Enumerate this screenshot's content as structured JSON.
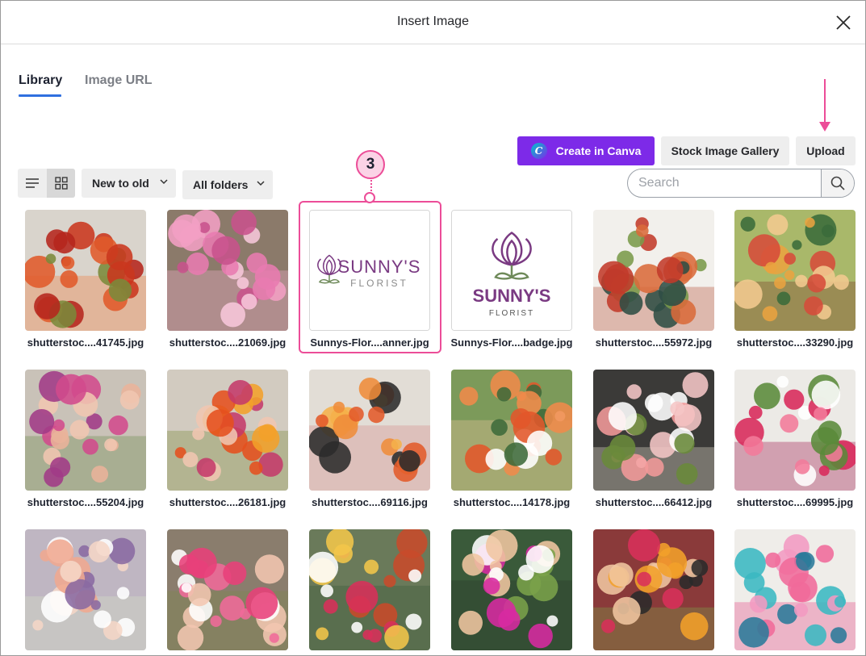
{
  "dialog": {
    "title": "Insert Image"
  },
  "tabs": [
    {
      "label": "Library",
      "active": true
    },
    {
      "label": "Image URL",
      "active": false
    }
  ],
  "actions": {
    "canva_label": "Create in Canva",
    "canva_logo_letter": "C",
    "stock_label": "Stock Image Gallery",
    "upload_label": "Upload"
  },
  "toolbar": {
    "sort_value": "New to old",
    "folder_value": "All folders",
    "search_placeholder": "Search"
  },
  "callout": {
    "step": "3"
  },
  "images": [
    {
      "name": "shutterstoc....41745.jpg",
      "kind": "wreath",
      "selected": false
    },
    {
      "name": "shutterstoc....21069.jpg",
      "kind": "pink-flowers",
      "selected": false
    },
    {
      "name": "Sunnys-Flor....anner.jpg",
      "kind": "logo-banner",
      "selected": true
    },
    {
      "name": "Sunnys-Flor....badge.jpg",
      "kind": "logo-badge",
      "selected": false
    },
    {
      "name": "shutterstoc....55972.jpg",
      "kind": "wreath-ring",
      "selected": false
    },
    {
      "name": "shutterstoc....33290.jpg",
      "kind": "florists",
      "selected": false
    },
    {
      "name": "shutterstoc....55204.jpg",
      "kind": "hands-pink",
      "selected": false
    },
    {
      "name": "shutterstoc....26181.jpg",
      "kind": "hands-orange",
      "selected": false
    },
    {
      "name": "shutterstoc....69116.jpg",
      "kind": "roses-cutting",
      "selected": false
    },
    {
      "name": "shutterstoc....14178.jpg",
      "kind": "woman-tulips",
      "selected": false
    },
    {
      "name": "shutterstoc....66412.jpg",
      "kind": "bouquet-pink",
      "selected": false
    },
    {
      "name": "shutterstoc....69995.jpg",
      "kind": "tulips-red",
      "selected": false
    },
    {
      "name": "",
      "kind": "bridal-bouquet",
      "selected": false
    },
    {
      "name": "",
      "kind": "hands-peony",
      "selected": false
    },
    {
      "name": "",
      "kind": "flower-shop",
      "selected": false
    },
    {
      "name": "",
      "kind": "man-plants",
      "selected": false
    },
    {
      "name": "",
      "kind": "man-smiling",
      "selected": false
    },
    {
      "name": "",
      "kind": "toy-truck",
      "selected": false
    }
  ],
  "logo": {
    "brand_line1": "SUNNY'S",
    "brand_line2": "FLORIST",
    "brand_color": "#7a3a82"
  },
  "colors": {
    "accent_pink": "#ec4d98",
    "canva_purple": "#7d2ae8",
    "tab_blue": "#2f6fdf"
  }
}
